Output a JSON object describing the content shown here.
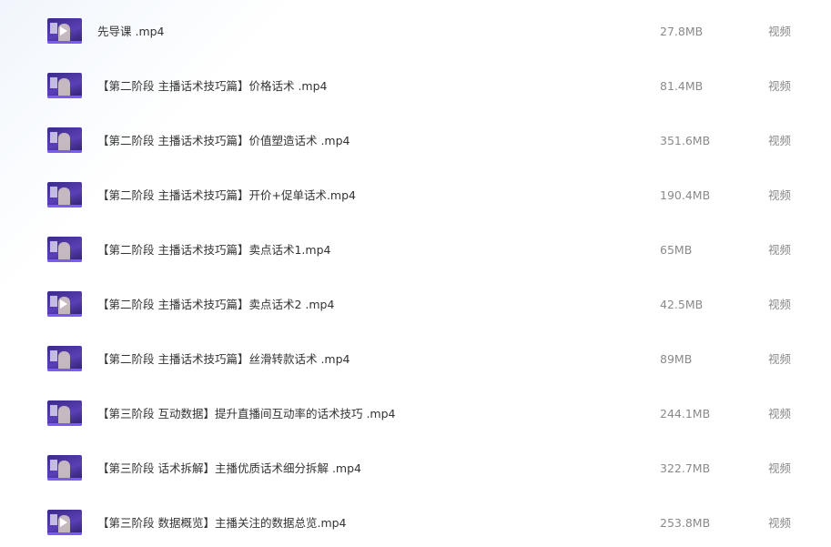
{
  "files": [
    {
      "name": "先导课 .mp4",
      "size": "27.8MB",
      "type": "视频",
      "icon": "video-thumbnail-icon"
    },
    {
      "name": "【第二阶段 主播话术技巧篇】价格话术 .mp4",
      "size": "81.4MB",
      "type": "视频",
      "icon": "video-thumbnail-icon"
    },
    {
      "name": "【第二阶段 主播话术技巧篇】价值塑造话术 .mp4",
      "size": "351.6MB",
      "type": "视频",
      "icon": "video-thumbnail-icon"
    },
    {
      "name": "【第二阶段 主播话术技巧篇】开价+促单话术.mp4",
      "size": "190.4MB",
      "type": "视频",
      "icon": "video-thumbnail-icon"
    },
    {
      "name": "【第二阶段 主播话术技巧篇】卖点话术1.mp4",
      "size": "65MB",
      "type": "视频",
      "icon": "video-thumbnail-icon"
    },
    {
      "name": "【第二阶段 主播话术技巧篇】卖点话术2 .mp4",
      "size": "42.5MB",
      "type": "视频",
      "icon": "video-thumbnail-icon"
    },
    {
      "name": "【第二阶段 主播话术技巧篇】丝滑转款话术 .mp4",
      "size": "89MB",
      "type": "视频",
      "icon": "video-thumbnail-icon"
    },
    {
      "name": "【第三阶段 互动数据】提升直播间互动率的话术技巧 .mp4",
      "size": "244.1MB",
      "type": "视频",
      "icon": "video-thumbnail-icon"
    },
    {
      "name": "【第三阶段 话术拆解】主播优质话术细分拆解 .mp4",
      "size": "322.7MB",
      "type": "视频",
      "icon": "video-thumbnail-icon"
    },
    {
      "name": "【第三阶段 数据概览】主播关注的数据总览.mp4",
      "size": "253.8MB",
      "type": "视频",
      "icon": "video-thumbnail-icon"
    }
  ],
  "colors": {
    "thumbnail_primary": "#3b2a86",
    "thumbnail_accent": "#7a5cf0",
    "name_text": "#333333",
    "meta_text": "#8a8a8a"
  }
}
